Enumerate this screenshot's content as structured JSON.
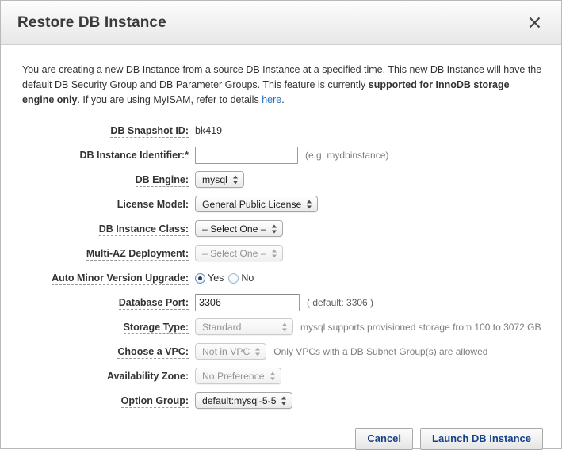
{
  "dialog": {
    "title": "Restore DB Instance",
    "close_icon": "close-icon"
  },
  "intro": {
    "part1": "You are creating a new DB Instance from a source DB Instance at a specified time. This new DB Instance will have the default DB Security Group and DB Parameter Groups. This feature is currently ",
    "bold": "supported for InnoDB storage engine only",
    "part2": ". If you are using MyISAM, refer to details ",
    "link": "here",
    "part3": "."
  },
  "form": {
    "db_snapshot_id": {
      "label": "DB Snapshot ID:",
      "value": "bk419"
    },
    "db_instance_identifier": {
      "label": "DB Instance Identifier:*",
      "value": "",
      "placeholder": "",
      "hint": "(e.g. mydbinstance)"
    },
    "db_engine": {
      "label": "DB Engine:",
      "value": "mysql"
    },
    "license_model": {
      "label": "License Model:",
      "value": "General Public License"
    },
    "db_instance_class": {
      "label": "DB Instance Class:",
      "value": "– Select One –"
    },
    "multi_az_deployment": {
      "label": "Multi-AZ Deployment:",
      "value": "– Select One –"
    },
    "auto_minor_version_upgrade": {
      "label": "Auto Minor Version Upgrade:",
      "yes_label": "Yes",
      "no_label": "No",
      "selected": "Yes"
    },
    "database_port": {
      "label": "Database Port:",
      "value": "3306",
      "hint": "( default: 3306 )"
    },
    "storage_type": {
      "label": "Storage Type:",
      "value": "Standard",
      "hint": "mysql supports provisioned storage from 100 to 3072 GB"
    },
    "choose_a_vpc": {
      "label": "Choose a VPC:",
      "value": "Not in VPC",
      "hint": "Only VPCs with a DB Subnet Group(s) are allowed"
    },
    "availability_zone": {
      "label": "Availability Zone:",
      "value": "No Preference"
    },
    "option_group": {
      "label": "Option Group:",
      "value": "default:mysql-5-5"
    }
  },
  "footer": {
    "cancel_label": "Cancel",
    "submit_label": "Launch DB Instance"
  },
  "colors": {
    "link": "#2a72c4",
    "button_text": "#15428b",
    "radio_accent": "#5b8fd0"
  }
}
